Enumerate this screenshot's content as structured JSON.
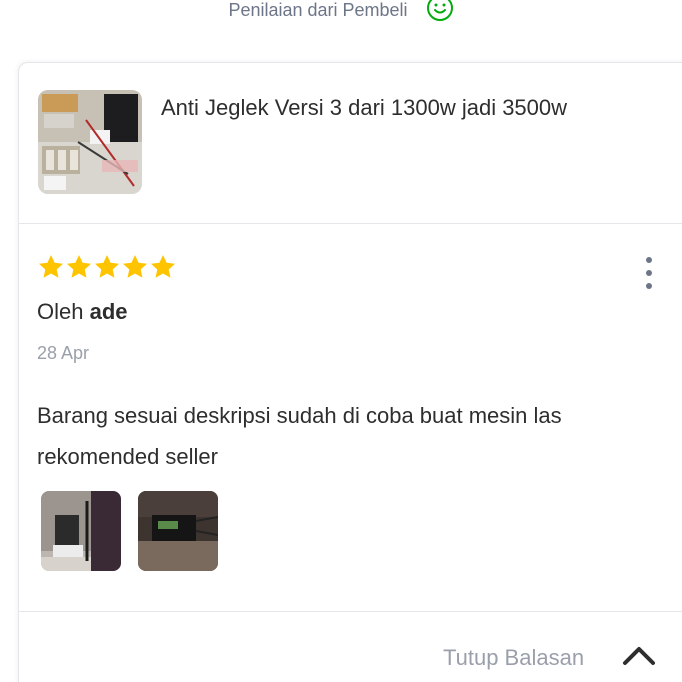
{
  "header": {
    "title": "Penilaian dari Pembeli",
    "icon": "smiley-icon"
  },
  "product": {
    "name": "Anti Jeglek Versi 3 dari 1300w jadi 3500w"
  },
  "review": {
    "rating": 5,
    "rating_max": 5,
    "by_prefix": "Oleh",
    "author": "ade",
    "date": "28 Apr",
    "text": "Barang sesuai deskripsi sudah di coba buat mesin las rekomended seller"
  },
  "footer": {
    "toggle_label": "Tutup Balasan"
  },
  "colors": {
    "accent_green": "#03ac0e",
    "star": "#ffc400",
    "muted_text": "#9aa0ab",
    "text": "#2e2e2e"
  }
}
